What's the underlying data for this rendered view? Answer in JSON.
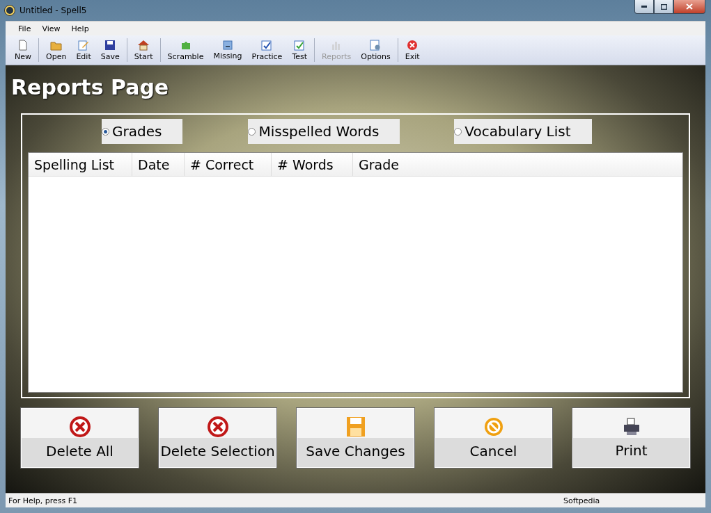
{
  "window": {
    "title": "Untitled - Spell5"
  },
  "menu": [
    "File",
    "View",
    "Help"
  ],
  "toolbar": [
    {
      "label": "New",
      "kind": "new",
      "disabled": false
    },
    {
      "label": "Open",
      "kind": "open",
      "disabled": false
    },
    {
      "label": "Edit",
      "kind": "edit",
      "disabled": false
    },
    {
      "label": "Save",
      "kind": "save",
      "disabled": false
    },
    {
      "label": "Start",
      "kind": "home",
      "disabled": false
    },
    {
      "label": "Scramble",
      "kind": "puzzle",
      "disabled": false
    },
    {
      "label": "Missing",
      "kind": "missing",
      "disabled": false
    },
    {
      "label": "Practice",
      "kind": "check",
      "disabled": false
    },
    {
      "label": "Test",
      "kind": "checkgreen",
      "disabled": false
    },
    {
      "label": "Reports",
      "kind": "chart",
      "disabled": true
    },
    {
      "label": "Options",
      "kind": "options",
      "disabled": false
    },
    {
      "label": "Exit",
      "kind": "exit",
      "disabled": false
    }
  ],
  "heading": "Reports Page",
  "report_types": [
    {
      "label": "Grades",
      "selected": true
    },
    {
      "label": "Misspelled Words",
      "selected": false
    },
    {
      "label": "Vocabulary List",
      "selected": false
    }
  ],
  "table": {
    "columns": [
      "Spelling List",
      "Date",
      "# Correct",
      "# Words",
      "Grade"
    ]
  },
  "buttons": [
    {
      "label": "Delete All",
      "kind": "delete"
    },
    {
      "label": "Delete Selection",
      "kind": "delete"
    },
    {
      "label": "Save Changes",
      "kind": "save"
    },
    {
      "label": "Cancel",
      "kind": "cancel"
    },
    {
      "label": "Print",
      "kind": "print"
    }
  ],
  "status_bar": {
    "help": "For Help, press F1",
    "right": "Softpedia"
  }
}
